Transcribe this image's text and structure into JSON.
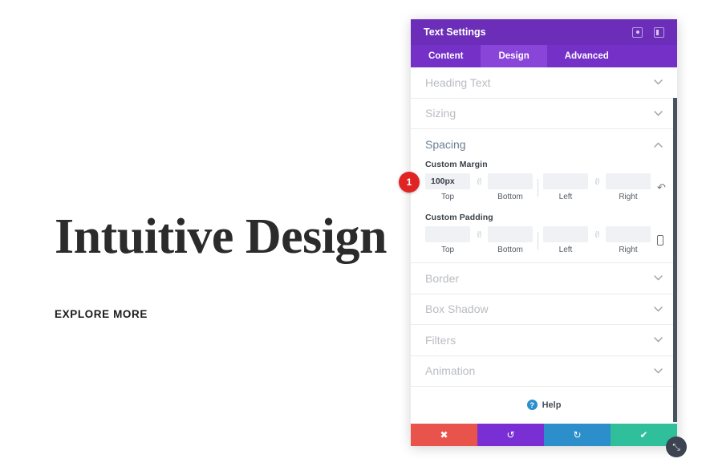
{
  "canvas": {
    "headline": "Intuitive Design",
    "cta_label": "EXPLORE MORE"
  },
  "panel": {
    "title": "Text Settings",
    "header_icons": [
      {
        "name": "fullscreen-icon"
      },
      {
        "name": "layout-toggle-icon"
      }
    ],
    "tabs": [
      {
        "label": "Content",
        "active": false
      },
      {
        "label": "Design",
        "active": true
      },
      {
        "label": "Advanced",
        "active": false
      }
    ],
    "sections": [
      {
        "label": "Heading Text",
        "open": false
      },
      {
        "label": "Sizing",
        "open": false
      },
      {
        "label": "Spacing",
        "open": true
      },
      {
        "label": "Border",
        "open": false
      },
      {
        "label": "Box Shadow",
        "open": false
      },
      {
        "label": "Filters",
        "open": false
      },
      {
        "label": "Animation",
        "open": false
      }
    ],
    "spacing": {
      "margin": {
        "label": "Custom Margin",
        "top": {
          "value": "100px",
          "sub": "Top"
        },
        "bottom": {
          "value": "",
          "sub": "Bottom"
        },
        "left": {
          "value": "",
          "sub": "Left"
        },
        "right": {
          "value": "",
          "sub": "Right"
        },
        "link_glyph": "⟨⁄⟩",
        "has_reset": true
      },
      "padding": {
        "label": "Custom Padding",
        "top": {
          "value": "",
          "sub": "Top"
        },
        "bottom": {
          "value": "",
          "sub": "Bottom"
        },
        "left": {
          "value": "",
          "sub": "Left"
        },
        "right": {
          "value": "",
          "sub": "Right"
        },
        "link_glyph": "⟨⁄⟩",
        "has_reset": false
      }
    },
    "help": {
      "badge": "?",
      "label": "Help"
    },
    "footer_buttons": [
      {
        "name": "discard-button",
        "glyph": "✖",
        "color": "#e8544b"
      },
      {
        "name": "undo-button",
        "glyph": "↺",
        "color": "#7a2fd4"
      },
      {
        "name": "redo-button",
        "glyph": "↻",
        "color": "#2c8ecb"
      },
      {
        "name": "save-button",
        "glyph": "✔",
        "color": "#2fbf9b"
      }
    ]
  },
  "badge": {
    "number": "1"
  },
  "resize_handle": {
    "glyph": "⤡"
  },
  "colors": {
    "header_purple": "#6c2eb9",
    "tabs_purple": "#7430c7",
    "tab_active": "#8944d8",
    "section_label": "#b9bcc2",
    "section_active_label": "#6b7f93",
    "input_bg": "#eff1f5",
    "badge_red": "#e02424"
  }
}
